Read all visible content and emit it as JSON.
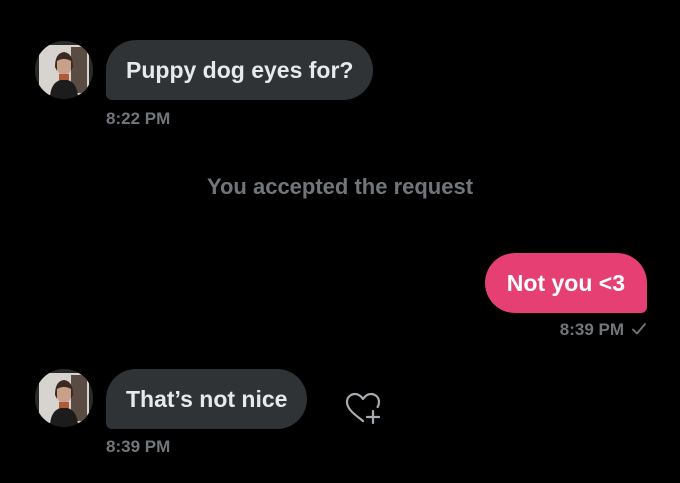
{
  "messages": [
    {
      "text": "Puppy dog eyes for?",
      "time": "8:22 PM"
    },
    {
      "text": "Not you <3",
      "time": "8:39 PM"
    },
    {
      "text": "That’s not nice",
      "time": "8:39 PM"
    }
  ],
  "system_notice": "You accepted the request",
  "colors": {
    "background": "#000000",
    "incoming_bubble": "#2f3336",
    "outgoing_bubble": "#e53f74",
    "meta_text": "#71767b"
  },
  "icons": {
    "read_receipt": "check-icon",
    "reaction": "heart-plus-icon"
  }
}
